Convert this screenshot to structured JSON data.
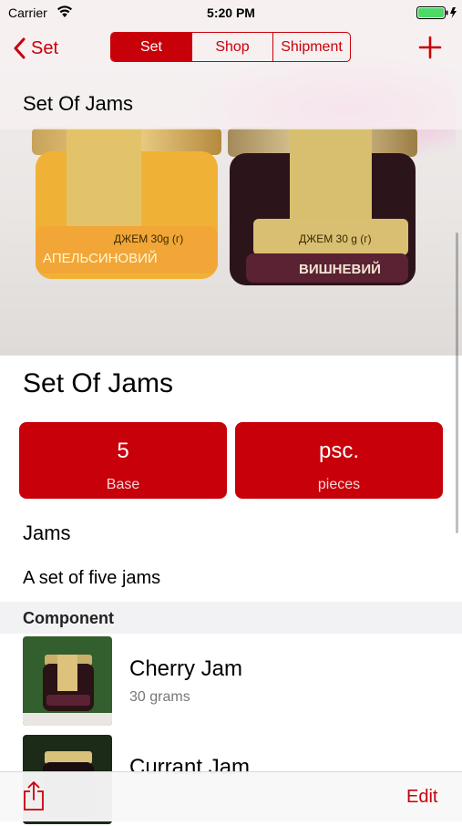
{
  "status_bar": {
    "carrier": "Carrier",
    "time": "5:20 PM",
    "icons": [
      "wifi-icon",
      "battery-icon",
      "charging-icon"
    ]
  },
  "nav": {
    "back_label": "Set",
    "segments": [
      {
        "label": "Set",
        "selected": true
      },
      {
        "label": "Shop",
        "selected": false
      },
      {
        "label": "Shipment",
        "selected": false
      }
    ],
    "add_icon": "plus-icon",
    "title": "Set Of Jams"
  },
  "hero": {
    "jars": [
      {
        "label_line1": "ДЖЕМ 30g (г)",
        "label_line2": "АПЕЛЬСИНОВИЙ"
      },
      {
        "label_line1": "ДЖЕМ 30 g (г)",
        "label_line2": "ВИШНЕВИЙ"
      }
    ]
  },
  "item": {
    "title": "Set Of Jams",
    "quantity": {
      "value": "5",
      "label": "Base"
    },
    "unit": {
      "value": "psc.",
      "label": "pieces"
    },
    "category": "Jams",
    "description": "A set of five jams"
  },
  "components": {
    "header": "Component",
    "items": [
      {
        "name": "Cherry Jam",
        "detail": "30 grams"
      },
      {
        "name": "Currant Jam",
        "detail": ""
      }
    ]
  },
  "toolbar": {
    "share_icon": "share-icon",
    "edit_label": "Edit"
  },
  "colors": {
    "accent": "#c8000a",
    "tile_bg": "#c8000a",
    "section_bg": "#f2f2f4"
  }
}
